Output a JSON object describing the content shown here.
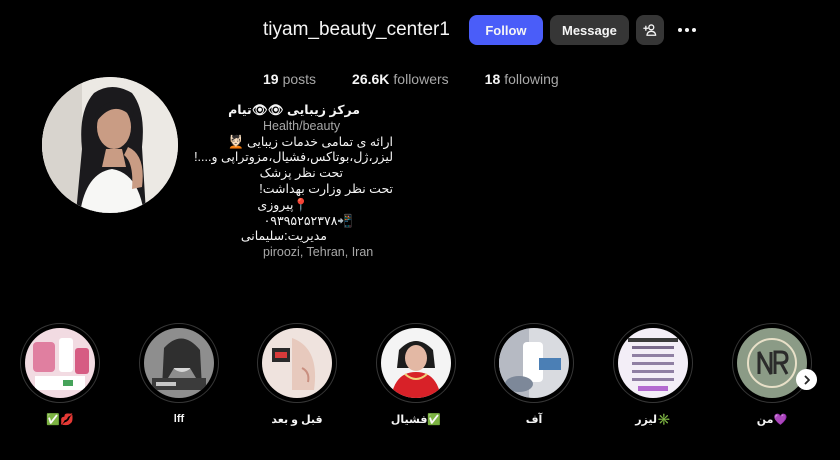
{
  "profile": {
    "username": "tiyam_beauty_center1",
    "follow_label": "Follow",
    "message_label": "Message",
    "avatar_icon": "profile-photo",
    "suggest_icon": "add-person-icon",
    "more_icon": "more-options-icon"
  },
  "stats": {
    "posts_count": "19",
    "posts_label": "posts",
    "followers_count": "26.6K",
    "followers_label": "followers",
    "following_count": "18",
    "following_label": "following"
  },
  "bio": {
    "name": "مرکز زیبایی 👁👁تیام",
    "category": "Health/beauty",
    "lines": [
      "ارائه ی تمامی خدمات زیبایی 💆🏻",
      "لیزر،ژل،بوتاکس،فشیال،مزوتراپی و....!",
      "تحت نظر پزشک",
      "تحت نظر وزارت بهداشت!",
      "📍پیروزی",
      "📲۰۹۳۹۵۲۵۲۳۷۸",
      "مدیریت:سلیمانی"
    ],
    "location": "piroozi, Tehran, Iran"
  },
  "highlights": [
    {
      "label": "✅💋",
      "thumb": "pink-products"
    },
    {
      "label": "lff",
      "thumb": "bw-woman"
    },
    {
      "label": "قبل و بعد",
      "thumb": "before-after"
    },
    {
      "label": "فشیال✅",
      "thumb": "woman-red"
    },
    {
      "label": "آف",
      "thumb": "treatment"
    },
    {
      "label": "لیزر✳️",
      "thumb": "price-list"
    },
    {
      "label": "من💜",
      "thumb": "nr-logo"
    }
  ],
  "colors": {
    "background": "#000000",
    "follow_button": "#4a5df9",
    "secondary_button": "#363636",
    "muted_text": "#a8a8a8"
  }
}
